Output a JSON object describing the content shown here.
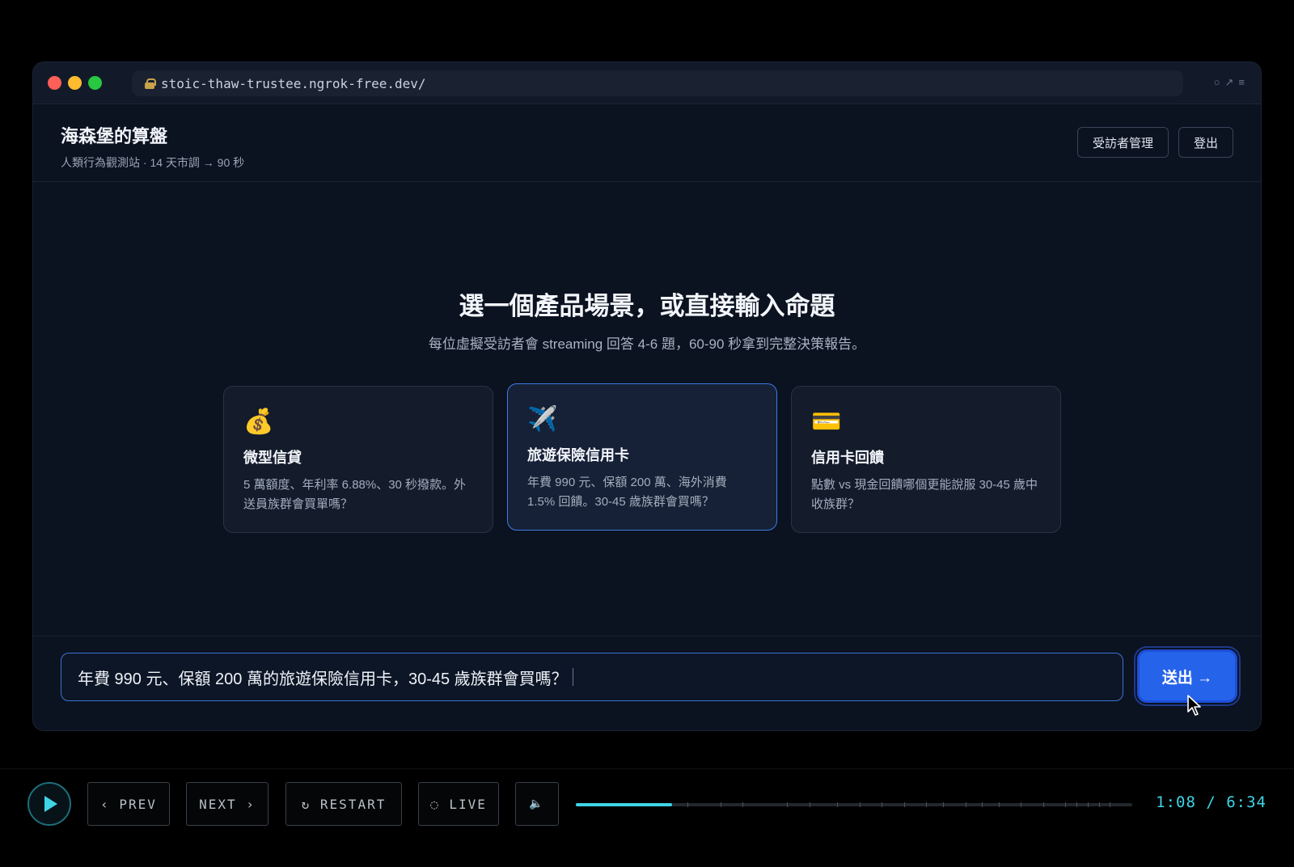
{
  "browser": {
    "url": "stoic-thaw-trustee.ngrok-free.dev/",
    "tools": [
      "○",
      "↗",
      "≡"
    ]
  },
  "header": {
    "title": "海森堡的算盤",
    "subtitle": "人類行為觀測站 · 14 天市調 → 90 秒",
    "manage_button": "受訪者管理",
    "logout_button": "登出"
  },
  "main": {
    "heading": "選一個產品場景，或直接輸入命題",
    "subheading": "每位虛擬受訪者會 streaming 回答 4-6 題，60-90 秒拿到完整決策報告。",
    "cards": [
      {
        "icon": "💰",
        "title": "微型信貸",
        "description": "5 萬額度、年利率 6.88%、30 秒撥款。外送員族群會買單嗎？",
        "selected": false
      },
      {
        "icon": "✈️",
        "title": "旅遊保險信用卡",
        "description": "年費 990 元、保額 200 萬、海外消費 1.5% 回饋。30-45 歲族群會買嗎？",
        "selected": true
      },
      {
        "icon": "💳",
        "title": "信用卡回饋",
        "description": "點數 vs 現金回饋哪個更能說服 30-45 歲中收族群？",
        "selected": false
      }
    ]
  },
  "composer": {
    "value": "年費 990 元、保額 200 萬的旅遊保險信用卡，30-45 歲族群會買嗎？",
    "send_button": "送出 →"
  },
  "player": {
    "prev": "‹ PREV",
    "next": "NEXT ›",
    "restart": "↻ RESTART",
    "live": "◌ LIVE",
    "mute_icon": "🔈",
    "time": "1:08 / 6:34",
    "progress_fraction": 0.173
  }
}
